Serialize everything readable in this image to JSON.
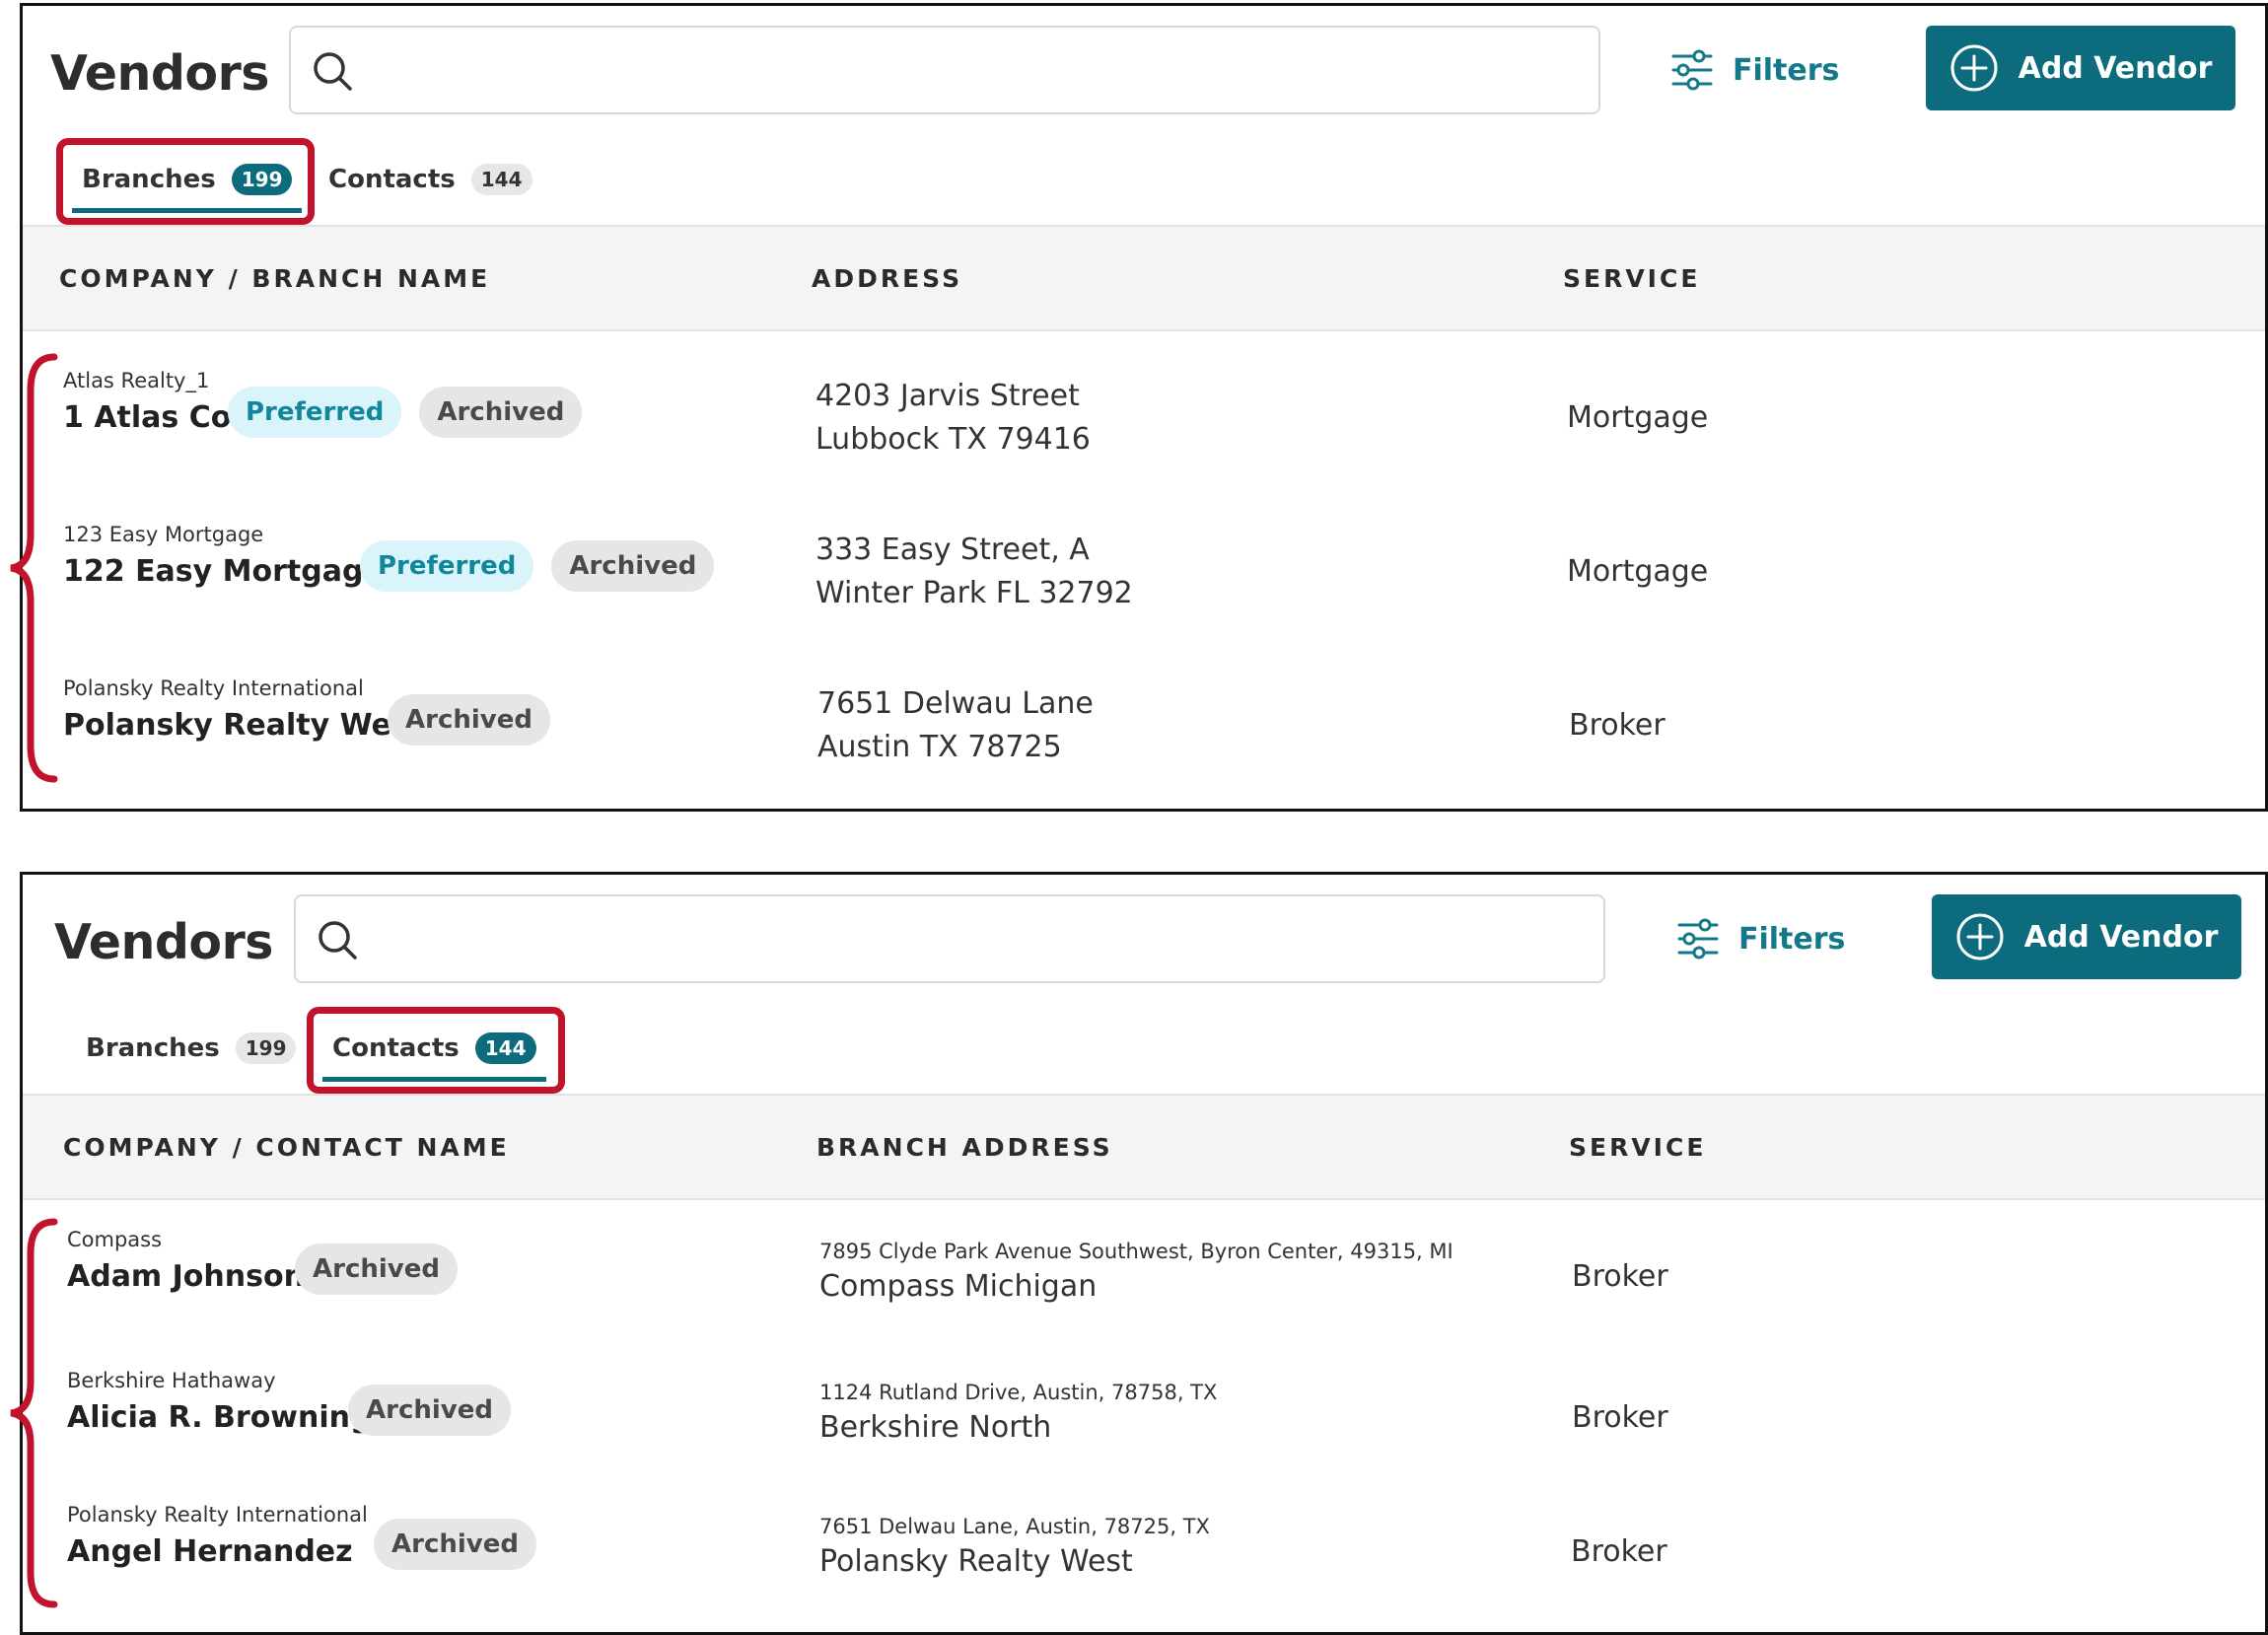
{
  "colors": {
    "accent": "#0c6b7c",
    "highlight": "#c1142c",
    "preferred_bg": "#d9f4fb",
    "archived_bg": "#e6e6e6"
  },
  "branches_panel": {
    "title": "Vendors",
    "search": {
      "value": "",
      "placeholder": ""
    },
    "filters_label": "Filters",
    "add_label": "Add Vendor",
    "tabs": [
      {
        "label": "Branches",
        "count": "199",
        "active": true
      },
      {
        "label": "Contacts",
        "count": "144",
        "active": false
      }
    ],
    "columns": [
      "COMPANY / BRANCH NAME",
      "ADDRESS",
      "SERVICE"
    ],
    "rows": [
      {
        "company": "Atlas Realty_1",
        "name": "1 Atlas Co",
        "badges": [
          "Preferred",
          "Archived"
        ],
        "address_line1": "4203 Jarvis Street",
        "address_line2": "Lubbock TX 79416",
        "service": "Mortgage"
      },
      {
        "company": "123 Easy Mortgage",
        "name": "122 Easy Mortgage",
        "badges": [
          "Preferred",
          "Archived"
        ],
        "address_line1": "333 Easy Street, A",
        "address_line2": "Winter Park FL 32792",
        "service": "Mortgage"
      },
      {
        "company": "Polansky Realty International",
        "name": "Polansky Realty West",
        "badges": [
          "Archived"
        ],
        "address_line1": "7651 Delwau Lane",
        "address_line2": "Austin TX 78725",
        "service": "Broker"
      }
    ]
  },
  "contacts_panel": {
    "title": "Vendors",
    "search": {
      "value": "",
      "placeholder": ""
    },
    "filters_label": "Filters",
    "add_label": "Add Vendor",
    "tabs": [
      {
        "label": "Branches",
        "count": "199",
        "active": false
      },
      {
        "label": "Contacts",
        "count": "144",
        "active": true
      }
    ],
    "columns": [
      "COMPANY / CONTACT NAME",
      "BRANCH ADDRESS",
      "SERVICE"
    ],
    "rows": [
      {
        "company": "Compass",
        "name": "Adam Johnson",
        "badges": [
          "Archived"
        ],
        "address_line1": "7895 Clyde Park Avenue Southwest, Byron Center, 49315, MI",
        "address_line2": "Compass Michigan",
        "service": "Broker"
      },
      {
        "company": "Berkshire Hathaway",
        "name": "Alicia R. Browning",
        "badges": [
          "Archived"
        ],
        "address_line1": "1124 Rutland Drive, Austin, 78758, TX",
        "address_line2": "Berkshire North",
        "service": "Broker"
      },
      {
        "company": "Polansky Realty International",
        "name": "Angel Hernandez",
        "badges": [
          "Archived"
        ],
        "address_line1": "7651 Delwau Lane, Austin, 78725, TX",
        "address_line2": "Polansky Realty West",
        "service": "Broker"
      }
    ]
  }
}
